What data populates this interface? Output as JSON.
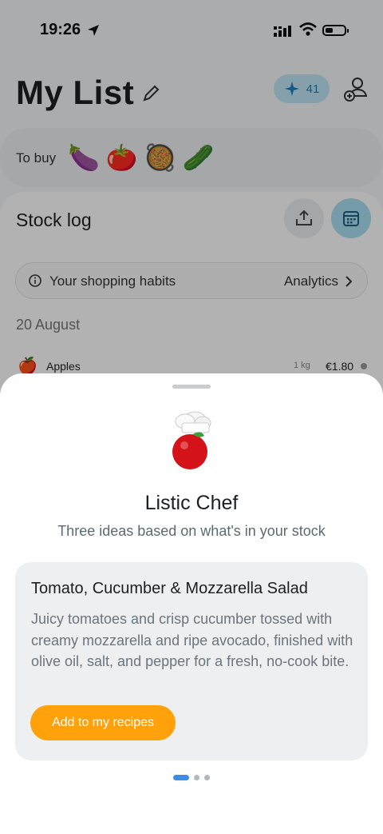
{
  "status_bar": {
    "time": "19:26"
  },
  "header": {
    "title": "My List",
    "credits": "41"
  },
  "to_buy": {
    "label": "To buy",
    "items": [
      "🍆",
      "🍅",
      "🥘",
      "🥒"
    ]
  },
  "stock_log": {
    "title": "Stock log",
    "habits_label": "Your shopping habits",
    "analytics_label": "Analytics",
    "date": "20 August",
    "rows": [
      {
        "icon": "🍎",
        "name": "Apples",
        "qty": "1 kg",
        "price": "€1.80"
      }
    ]
  },
  "sheet": {
    "title": "Listic Chef",
    "subtitle": "Three ideas based on what's in your stock",
    "recipe": {
      "title": "Tomato, Cucumber & Mozzarella Salad",
      "description": "Juicy tomatoes and crisp cucumber tossed with creamy mozzarella and ripe avocado, finished with olive oil, salt, and pepper for a fresh, no-cook bite.",
      "button": "Add to my recipes"
    },
    "pager": {
      "count": 3,
      "active": 0
    }
  },
  "colors": {
    "accent": "#ffa10a",
    "pager_active": "#3d8ce6",
    "credit_bg": "#bfe6f5"
  }
}
